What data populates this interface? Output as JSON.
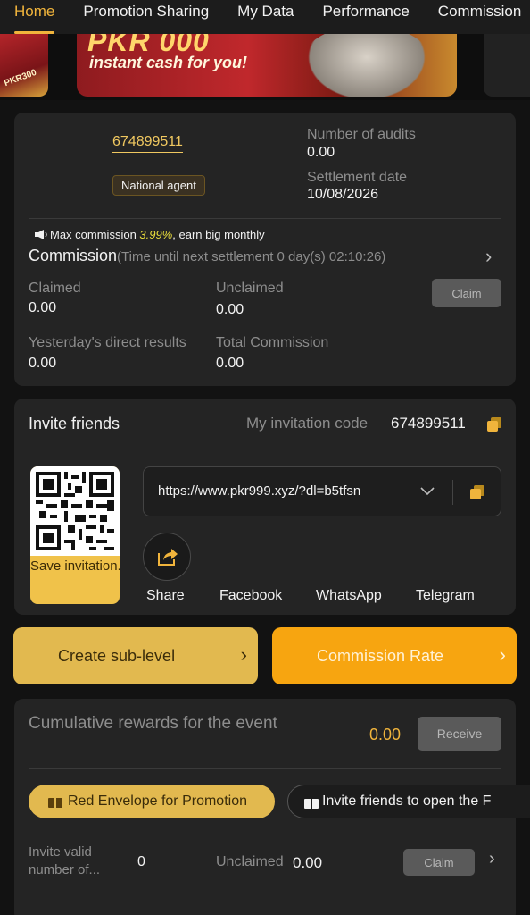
{
  "tabs": [
    "Home",
    "Promotion Sharing",
    "My Data",
    "Performance",
    "Commission"
  ],
  "active_tab": "Home",
  "banner": {
    "headline": "PKR 000",
    "tagline": "instant cash for you!",
    "side_label": "PKR300"
  },
  "agent": {
    "id": "674899511",
    "level_badge": "National agent",
    "audits_label": "Number of audits",
    "audits_value": "0.00",
    "settlement_label": "Settlement date",
    "settlement_value": "10/08/2026"
  },
  "commission": {
    "promo_prefix": "Max commission ",
    "promo_rate": "3.99%",
    "promo_suffix": ", earn big monthly",
    "title": "Commission",
    "timer": "(Time until next settlement  0 day(s) 02:10:26)",
    "claimed_label": "Claimed",
    "claimed_value": "0.00",
    "unclaimed_label": "Unclaimed",
    "unclaimed_value": "0.00",
    "claim_button": "Claim",
    "yesterday_label": "Yesterday's direct results",
    "yesterday_value": "0.00",
    "total_label": "Total Commission",
    "total_value": "0.00"
  },
  "invite": {
    "title": "Invite friends",
    "code_label": "My invitation code",
    "code_value": "674899511",
    "save_label": "Save invitation...",
    "link": "https://www.pkr999.xyz/?dl=b5tfsn",
    "share_label": "Share",
    "facebook_label": "Facebook",
    "whatsapp_label": "WhatsApp",
    "telegram_label": "Telegram"
  },
  "actions": {
    "sub_level": "Create sub-level",
    "commission_rate": "Commission Rate"
  },
  "event": {
    "cumulative_label": "Cumulative rewards for the event",
    "cumulative_value": "0.00",
    "receive_button": "Receive",
    "red_envelope": "Red Envelope for Promotion",
    "invite_open": "Invite friends to open the F",
    "valid_label": "Invite valid number of...",
    "valid_value": "0",
    "unclaimed_label": "Unclaimed",
    "unclaimed_value": "0.00",
    "claim_button": "Claim"
  },
  "colors": {
    "accent": "#f0b43c",
    "card": "#242424",
    "background": "#121212",
    "orange": "#f7a510",
    "muted_gold": "#e2b94f"
  }
}
